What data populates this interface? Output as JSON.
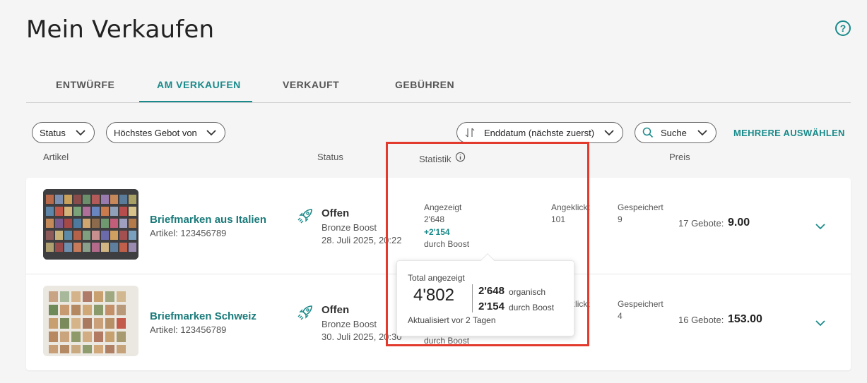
{
  "page": {
    "title": "Mein Verkaufen",
    "help_icon": "question-circle-icon"
  },
  "tabs": [
    {
      "label": "ENTWÜRFE",
      "active": false
    },
    {
      "label": "AM VERKAUFEN",
      "active": true
    },
    {
      "label": "VERKAUFT",
      "active": false
    },
    {
      "label": "GEBÜHREN",
      "active": false
    }
  ],
  "filters": {
    "status": "Status",
    "highest_bid": "Höchstes Gebot von",
    "sort": "Enddatum (nächste zuerst)",
    "search": "Suche",
    "select_multiple": "MEHRERE AUSWÄHLEN"
  },
  "columns": {
    "article": "Artikel",
    "status": "Status",
    "statistics": "Statistik",
    "price": "Preis"
  },
  "items": [
    {
      "title": "Briefmarken aus Italien",
      "article_id": "Artikel: 123456789",
      "status": "Offen",
      "boost": "Bronze Boost",
      "end_date": "28. Juli 2025, 20:22",
      "shown_label": "Angezeigt",
      "shown": "2'648",
      "boost_plus": "+2'154",
      "boost_by": "durch Boost",
      "clicked_label": "Angeklickt",
      "clicked": "101",
      "saved_label": "Gespeichert",
      "saved": "9",
      "bids": "17 Gebote:",
      "price": "9.00"
    },
    {
      "title": "Briefmarken Schweiz",
      "article_id": "Artikel: 123456789",
      "status": "Offen",
      "boost": "Bronze Boost",
      "end_date": "30. Juli 2025, 20:30",
      "clicked_label": "Angeklickt",
      "boost_by": "durch Boost",
      "saved_label": "Gespeichert",
      "saved": "4",
      "bids": "16 Gebote:",
      "price": "153.00"
    }
  ],
  "popover": {
    "label": "Total angezeigt",
    "total": "4'802",
    "organic_value": "2'648",
    "organic_label": "organisch",
    "boost_value": "2'154",
    "boost_label": "durch Boost",
    "updated": "Aktualisiert vor 2 Tagen"
  },
  "colors": {
    "accent": "#1a8a8a",
    "highlight": "#e23a2c"
  }
}
